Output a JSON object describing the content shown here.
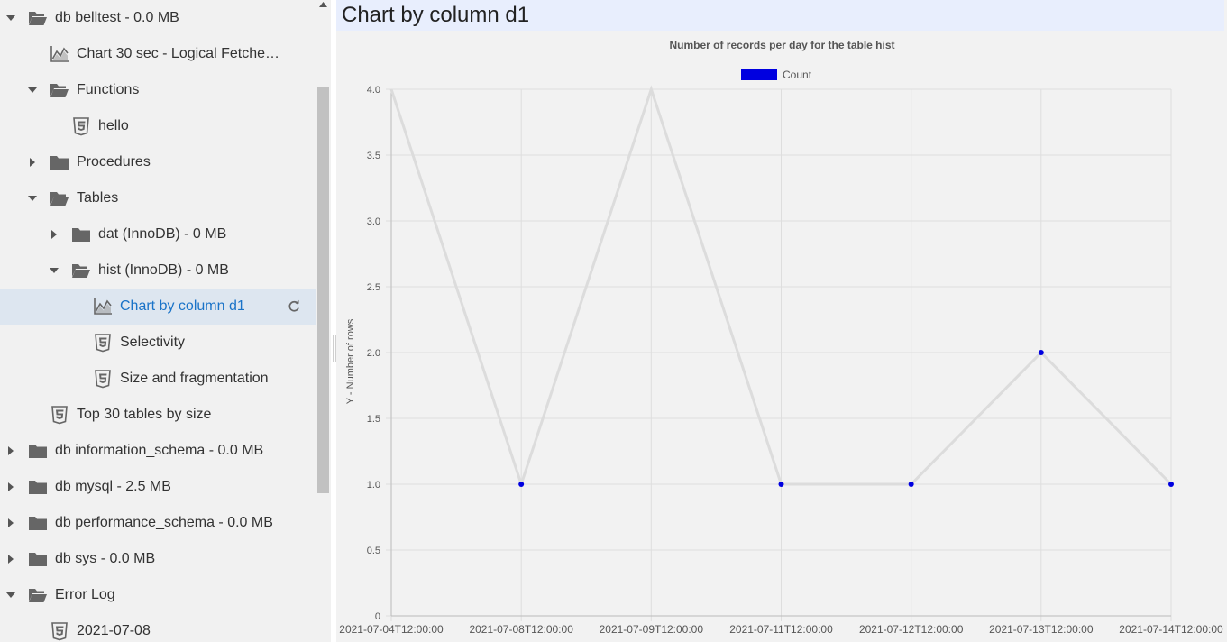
{
  "tree": {
    "rows": [
      {
        "label": "db belltest - 0.0 MB",
        "depth": 0,
        "expander": "open",
        "icon": "folder-open",
        "selected": false
      },
      {
        "label": "Chart 30 sec - Logical Fetche…",
        "depth": 1,
        "expander": "none",
        "icon": "chart",
        "selected": false
      },
      {
        "label": "Functions",
        "depth": 1,
        "expander": "open",
        "icon": "folder-open",
        "selected": false
      },
      {
        "label": "hello",
        "depth": 2,
        "expander": "none",
        "icon": "html5",
        "selected": false
      },
      {
        "label": "Procedures",
        "depth": 1,
        "expander": "closed",
        "icon": "folder",
        "selected": false
      },
      {
        "label": "Tables",
        "depth": 1,
        "expander": "open",
        "icon": "folder-open",
        "selected": false
      },
      {
        "label": "dat (InnoDB) - 0 MB",
        "depth": 2,
        "expander": "closed",
        "icon": "folder",
        "selected": false
      },
      {
        "label": "hist (InnoDB) - 0 MB",
        "depth": 2,
        "expander": "open",
        "icon": "folder-open",
        "selected": false
      },
      {
        "label": "Chart by column d1",
        "depth": 3,
        "expander": "none",
        "icon": "chart",
        "selected": true
      },
      {
        "label": "Selectivity",
        "depth": 3,
        "expander": "none",
        "icon": "html5",
        "selected": false
      },
      {
        "label": "Size and fragmentation",
        "depth": 3,
        "expander": "none",
        "icon": "html5",
        "selected": false
      },
      {
        "label": "Top 30 tables by size",
        "depth": 1,
        "expander": "none",
        "icon": "html5",
        "selected": false
      },
      {
        "label": "db information_schema - 0.0 MB",
        "depth": 0,
        "expander": "closed",
        "icon": "folder",
        "selected": false
      },
      {
        "label": "db mysql - 2.5 MB",
        "depth": 0,
        "expander": "closed",
        "icon": "folder",
        "selected": false
      },
      {
        "label": "db performance_schema - 0.0 MB",
        "depth": 0,
        "expander": "closed",
        "icon": "folder",
        "selected": false
      },
      {
        "label": "db sys - 0.0 MB",
        "depth": 0,
        "expander": "closed",
        "icon": "folder",
        "selected": false
      },
      {
        "label": "Error Log",
        "depth": 0,
        "expander": "open",
        "icon": "folder-open",
        "selected": false
      },
      {
        "label": "2021-07-08",
        "depth": 1,
        "expander": "none",
        "icon": "html5",
        "selected": false
      }
    ]
  },
  "pane": {
    "title": "Chart by column d1"
  },
  "chart_data": {
    "type": "line",
    "title": "Number of records per day for the table hist",
    "xlabel": "",
    "ylabel": "Y - Number of rows",
    "categories": [
      "2021-07-04T12:00:00",
      "2021-07-08T12:00:00",
      "2021-07-09T12:00:00",
      "2021-07-11T12:00:00",
      "2021-07-12T12:00:00",
      "2021-07-13T12:00:00",
      "2021-07-14T12:00:00"
    ],
    "series": [
      {
        "name": "Count",
        "values": [
          4,
          1,
          4,
          1,
          1,
          2,
          1
        ]
      }
    ],
    "ylim": [
      0,
      4
    ],
    "yticks": [
      "0",
      "0.5",
      "1.0",
      "1.5",
      "2.0",
      "2.5",
      "3.0",
      "3.5",
      "4.0"
    ],
    "grid": true,
    "legend": "top-center",
    "colors": {
      "line": "#dcdcdc",
      "point": "#0000e0",
      "legend_swatch": "#0000e0",
      "grid": "#dedede"
    }
  }
}
